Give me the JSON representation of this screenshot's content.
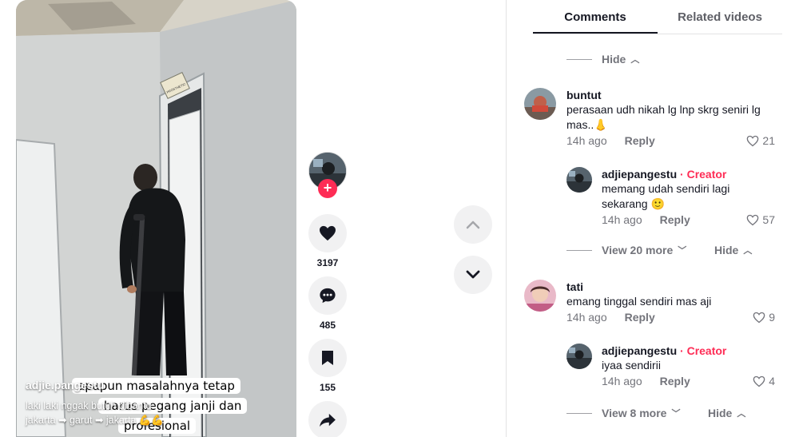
{
  "video": {
    "author": "adjie.pangestu",
    "description": "laki laki nggak butuh dibantu\njakarta ➡ garut ➡ jakarta 💪💪",
    "overlay_lines": [
      "apapun masalahnya tetap",
      "harus pegang janji dan",
      "profesional"
    ],
    "sign_text": "PROSTHETIC"
  },
  "actions": {
    "follow_label": "+",
    "likes": "3197",
    "comments": "485",
    "saves": "155"
  },
  "tabs": [
    {
      "label": "Comments",
      "active": true
    },
    {
      "label": "Related videos",
      "active": false
    }
  ],
  "thread": {
    "top_hide": "Hide",
    "comments": [
      {
        "username": "buntut",
        "text": "perasaan udh nikah lg lnp skrg seniri lg mas..👃",
        "time": "14h ago",
        "reply": "Reply",
        "likes": "21",
        "replies": [
          {
            "username": "adjiepangestu",
            "badge": "· Creator",
            "text": "memang udah sendiri lagi sekarang 🙂",
            "time": "14h ago",
            "reply": "Reply",
            "likes": "57"
          }
        ],
        "view_more": "View 20 more",
        "hide": "Hide"
      },
      {
        "username": "tati",
        "text": "emang tinggal sendiri mas aji",
        "time": "14h ago",
        "reply": "Reply",
        "likes": "9",
        "replies": [
          {
            "username": "adjiepangestu",
            "badge": "· Creator",
            "text": "iyaa sendirii",
            "time": "14h ago",
            "reply": "Reply",
            "likes": "4"
          }
        ],
        "view_more": "View 8 more",
        "hide": "Hide"
      }
    ]
  },
  "colors": {
    "accent": "#fe2c55",
    "muted": "#73747b",
    "button_bg": "#f1f1f2"
  }
}
